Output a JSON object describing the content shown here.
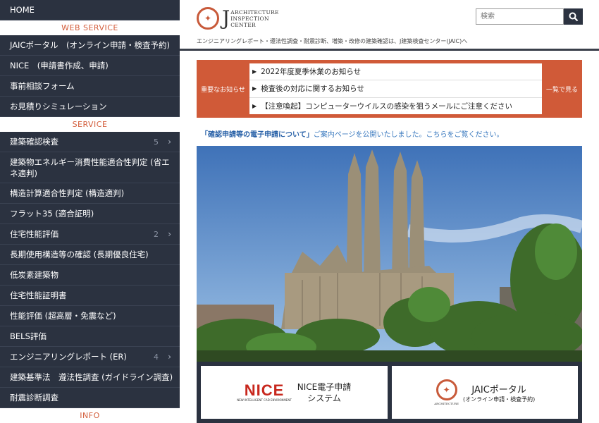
{
  "sidebar": {
    "home": "HOME",
    "section_web": "WEB SERVICE",
    "web_items": [
      "JAICポータル　(オンライン申請・検査予約)",
      "NICE　(申請書作成、申請)",
      "事前相談フォーム",
      "お見積りシミュレーション"
    ],
    "section_service": "SERVICE",
    "service_items": [
      {
        "label": "建築確認検査",
        "count": "5"
      },
      {
        "label": "建築物エネルギー消費性能適合性判定 (省エネ適判)"
      },
      {
        "label": "構造計算適合性判定 (構造適判)"
      },
      {
        "label": "フラット35 (適合証明)"
      },
      {
        "label": "住宅性能評価",
        "count": "2"
      },
      {
        "label": "長期使用構造等の確認 (長期優良住宅)"
      },
      {
        "label": "低炭素建築物"
      },
      {
        "label": "住宅性能証明書"
      },
      {
        "label": "性能評価 (超高層・免震など)"
      },
      {
        "label": "BELS評価"
      },
      {
        "label": "エンジニアリングレポート (ER)",
        "count": "4"
      },
      {
        "label": "建築基準法　遵法性調査 (ガイドライン調査)"
      },
      {
        "label": "耐震診断調査"
      }
    ],
    "section_info": "INFO"
  },
  "header": {
    "logo_j": "J",
    "logo_lines": [
      "ARCHITECTURE",
      "INSPECTION",
      "CENTER"
    ],
    "tagline": "エンジニアリングレポート・遵法性調査・耐震診断、増築・改修の建築確認は、J建築検査センター(JAIC)へ",
    "search_placeholder": "検索"
  },
  "notice": {
    "label": "重要なお知らせ",
    "items": [
      "2022年度夏季休業のお知らせ",
      "検査後の対応に関するお知らせ",
      "【注意喚起】コンピューターウイルスの感染を狙うメールにご注意ください"
    ],
    "more": "一覧で見る"
  },
  "announce": {
    "bold": "「確認申請等の電子申請について」",
    "rest": "ご案内ページを公開いたしました。こちらをご覧ください。"
  },
  "cards": {
    "nice_logo": "NICE",
    "nice_sub": "NEW INTELLIGENT CAD ENVIRONMENT",
    "nice_title_1": "NICE電子申請",
    "nice_title_2": "システム",
    "jaic_title": "JAICポータル",
    "jaic_sub": "(オンライン申請・検査予約)"
  },
  "colors": {
    "sidebar_bg": "#2b3240",
    "accent": "#d05a38",
    "link": "#3b7abf"
  }
}
